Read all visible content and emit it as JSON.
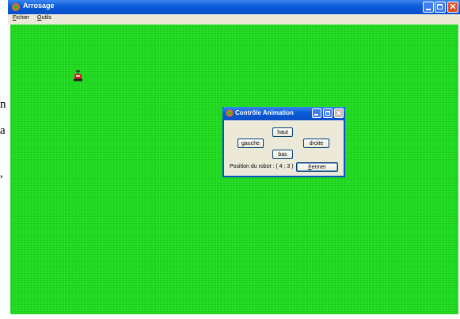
{
  "page_letters": [
    "n",
    "a",
    ","
  ],
  "window": {
    "title": "Arrosage",
    "menu": [
      {
        "first": "F",
        "rest": "ichier"
      },
      {
        "first": "O",
        "rest": "utils"
      }
    ]
  },
  "dialog": {
    "title": "Contrôle Animation",
    "buttons": {
      "up": "haut",
      "left": "gauche",
      "right": "droite",
      "down": "bas",
      "close_first": "F",
      "close_rest": "ermer"
    },
    "position_label": "Position du robot : ( 4 ; 3 )"
  },
  "colors": {
    "field": "#1fdc1f",
    "titlebar": "#0a5ad9",
    "robot": "#d62020"
  },
  "icons": [
    "app-icon",
    "minimize-icon",
    "maximize-icon",
    "close-icon",
    "robot-icon"
  ]
}
